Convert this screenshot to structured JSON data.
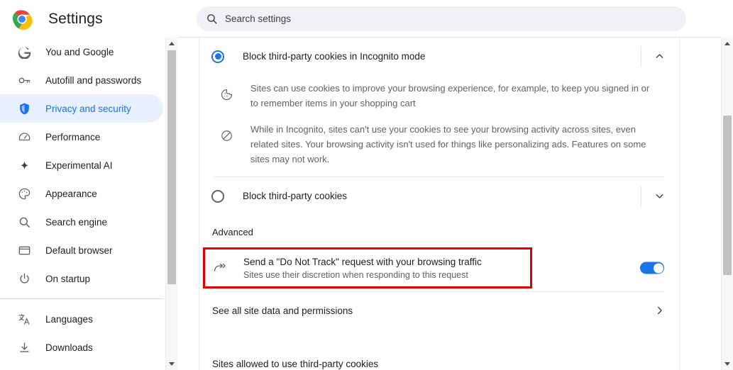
{
  "header": {
    "title": "Settings",
    "logo_icon": "chrome-logo",
    "search": {
      "placeholder": "Search settings",
      "value": "",
      "icon": "search-icon"
    }
  },
  "sidebar": {
    "items": [
      {
        "label": "You and Google",
        "icon": "google-g-icon",
        "selected": false
      },
      {
        "label": "Autofill and passwords",
        "icon": "key-icon",
        "selected": false
      },
      {
        "label": "Privacy and security",
        "icon": "shield-icon",
        "selected": true
      },
      {
        "label": "Performance",
        "icon": "speedometer-icon",
        "selected": false
      },
      {
        "label": "Experimental AI",
        "icon": "sparkle-icon",
        "selected": false
      },
      {
        "label": "Appearance",
        "icon": "palette-icon",
        "selected": false
      },
      {
        "label": "Search engine",
        "icon": "search-icon",
        "selected": false
      },
      {
        "label": "Default browser",
        "icon": "browser-window-icon",
        "selected": false
      },
      {
        "label": "On startup",
        "icon": "power-icon",
        "selected": false
      },
      {
        "label": "Languages",
        "icon": "translate-icon",
        "selected": false
      },
      {
        "label": "Downloads",
        "icon": "download-icon",
        "selected": false
      }
    ],
    "separator_after_index": 8,
    "scrollbar": {
      "up_arrow": "scroll-up-arrow-icon",
      "down_arrow": "scroll-down-arrow-icon"
    }
  },
  "main": {
    "incognito_option": {
      "label": "Block third-party cookies in Incognito mode",
      "radio_state": "selected",
      "expand_icon": "chevron-up-icon",
      "details": [
        {
          "icon": "cookie-icon",
          "text": "Sites can use cookies to improve your browsing experience, for example, to keep you signed in or to remember items in your shopping cart"
        },
        {
          "icon": "block-icon",
          "text": "While in Incognito, sites can't use your cookies to see your browsing activity across sites, even related sites. Your browsing activity isn't used for things like personalizing ads. Features on some sites may not work."
        }
      ]
    },
    "block_all_option": {
      "label": "Block third-party cookies",
      "radio_state": "unselected",
      "expand_icon": "chevron-down-icon"
    },
    "advanced_heading": "Advanced",
    "do_not_track": {
      "icon": "send-request-arrow-icon",
      "title": "Send a \"Do Not Track\" request with your browsing traffic",
      "subtitle": "Sites use their discretion when responding to this request",
      "toggle_state": "on",
      "highlight_color": "#e00000"
    },
    "site_data_link": {
      "label": "See all site data and permissions",
      "chevron_icon": "chevron-right-icon"
    },
    "allowed_sites_heading": "Sites allowed to use third-party cookies",
    "scrollbar": {
      "up_arrow": "scroll-up-arrow-icon",
      "down_arrow": "scroll-down-arrow-icon"
    }
  },
  "colors": {
    "accent": "#1a73e8",
    "selected_nav_bg": "#e8f0fe",
    "search_bg": "#eff1f6",
    "highlight_red": "#e00000"
  }
}
